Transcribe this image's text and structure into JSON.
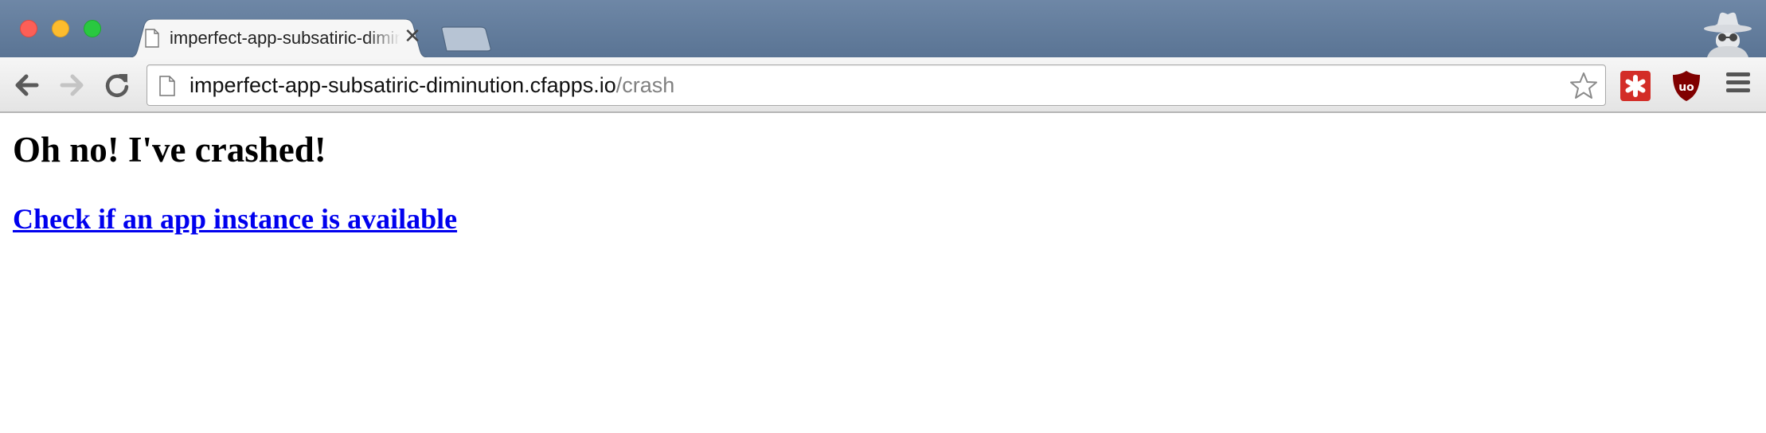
{
  "browser": {
    "tab": {
      "title": "imperfect-app-subsatiric-diminution.cfapps.io/crash",
      "close_glyph": "✕"
    },
    "address_bar": {
      "host": "imperfect-app-subsatiric-diminution.cfapps.io",
      "path": "/crash"
    },
    "icons": {
      "back": "back-arrow-icon",
      "forward": "forward-arrow-icon",
      "reload": "reload-icon",
      "page": "page-icon",
      "bookmark": "star-icon",
      "extension_1": "lastpass-icon",
      "extension_2": "ublock-origin-icon",
      "menu": "hamburger-menu-icon",
      "incognito": "incognito-icon"
    },
    "colors": {
      "tabstrip": "#5f7a9a",
      "link": "#0000ee",
      "lastpass": "#d32d27",
      "ublock": "#800000"
    }
  },
  "page": {
    "heading": "Oh no! I've crashed!",
    "link_text": "Check if an app instance is available"
  }
}
